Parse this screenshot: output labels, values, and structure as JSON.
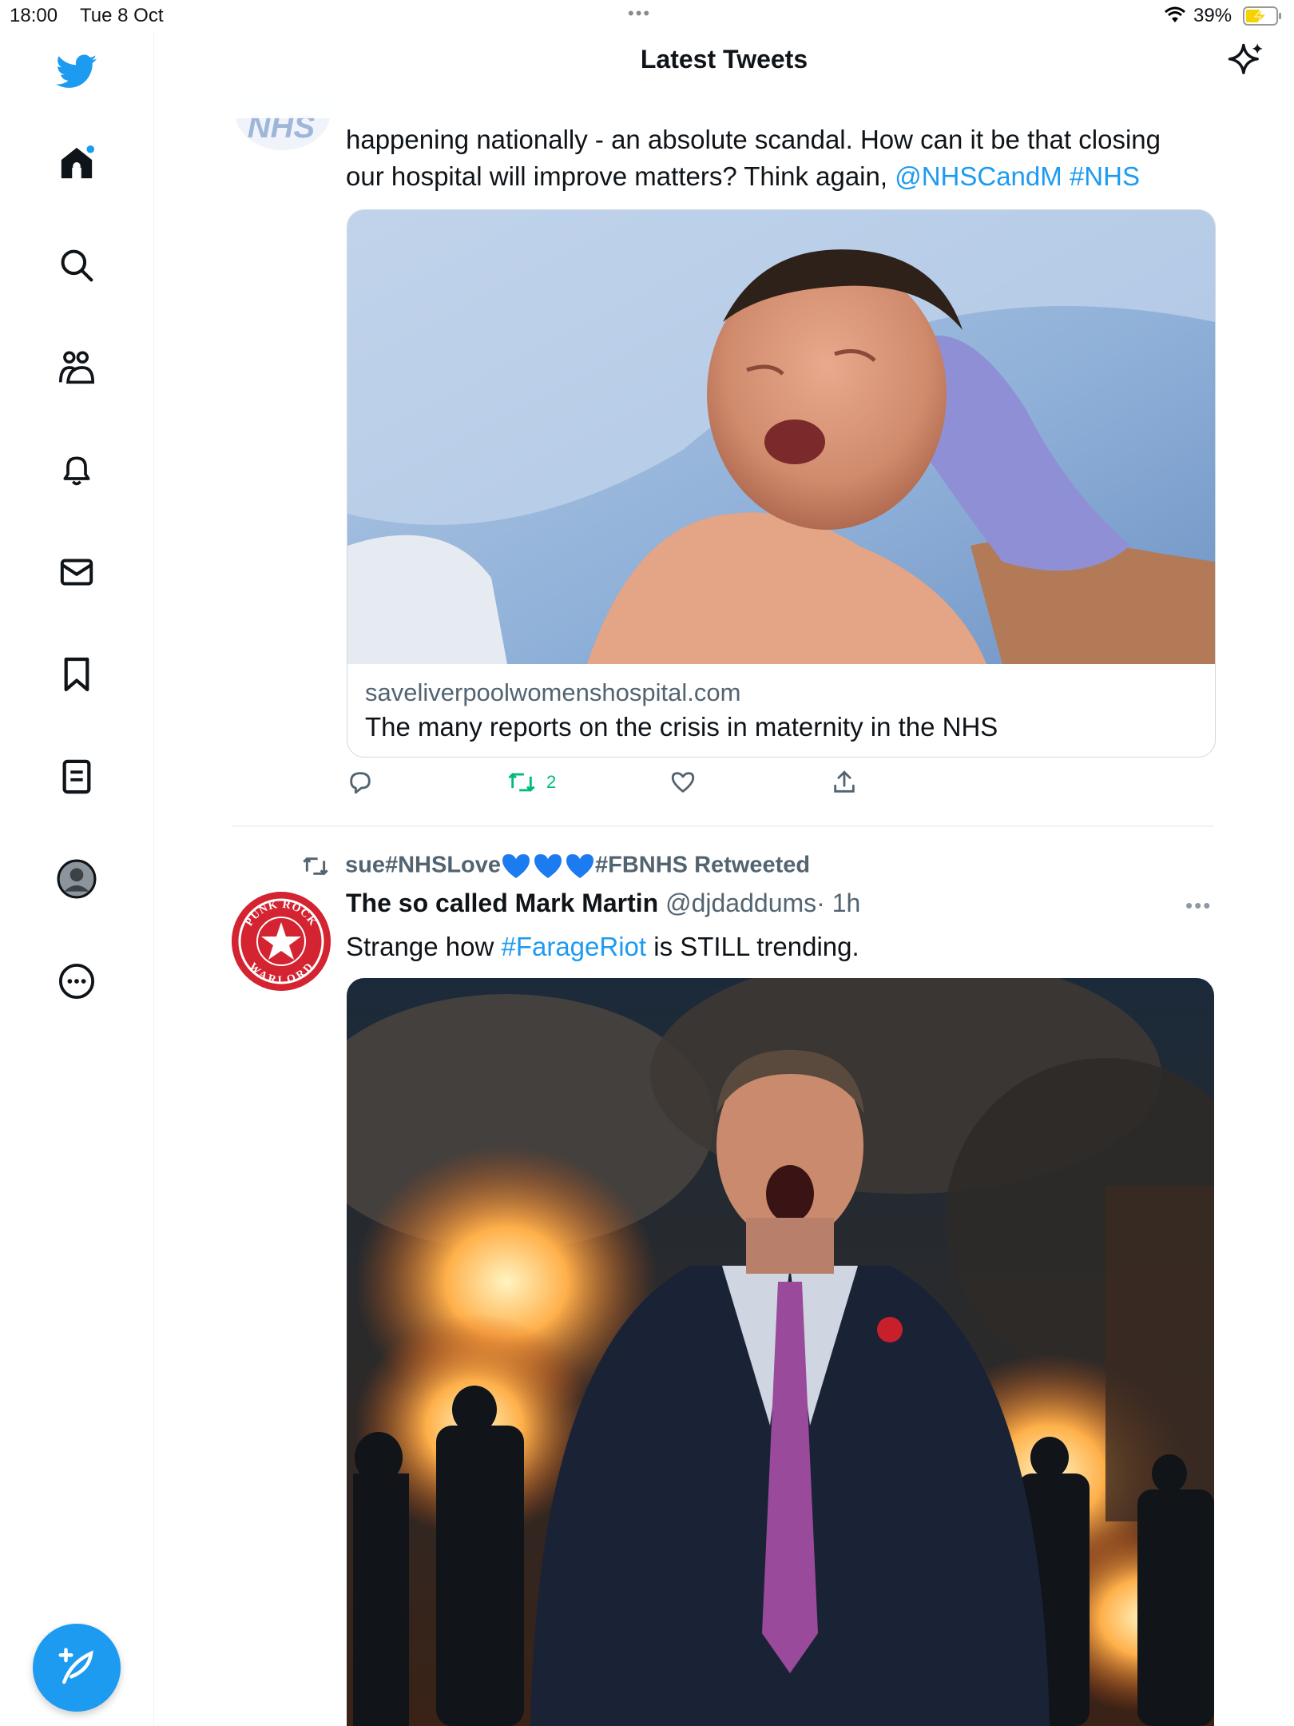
{
  "status_bar": {
    "time": "18:00",
    "date": "Tue 8 Oct",
    "battery": "39%"
  },
  "header": {
    "title": "Latest Tweets"
  },
  "sidebar": {
    "items": [
      "twitter-logo-icon",
      "home-icon",
      "search-icon",
      "communities-icon",
      "notifications-icon",
      "messages-icon",
      "bookmarks-icon",
      "lists-icon",
      "profile-icon",
      "more-icon"
    ],
    "compose_icon": "compose-icon"
  },
  "tweet1": {
    "avatar_text": "NHS",
    "text_line1": "happening nationally - an absolute scandal. How can it be that closing",
    "text_line2_plain": "our hospital will improve matters? Think again, ",
    "mention": "@NHSCandM",
    "hashtag": "#NHS",
    "card": {
      "domain": "saveliverpoolwomenshospital.com",
      "title": "The many reports on the crisis in maternity in the NHS"
    },
    "retweet_count": "2"
  },
  "tweet2": {
    "retweeted_by_prefix": "sue#NHSLove",
    "retweeted_by_suffix": "#FBNHS Retweeted",
    "author_name": "The so called Mark Martin",
    "author_handle": "@djdaddums",
    "time": "· 1h",
    "text_before": "Strange how ",
    "hashtag": "#FarageRiot",
    "text_after": " is STILL trending.",
    "avatar_text_top": "PUNK ROCK",
    "avatar_text_bottom": "WARLORD"
  },
  "colors": {
    "accent": "#1d9bf0",
    "retweet_green": "#00ba7c",
    "secondary_text": "#536471"
  }
}
